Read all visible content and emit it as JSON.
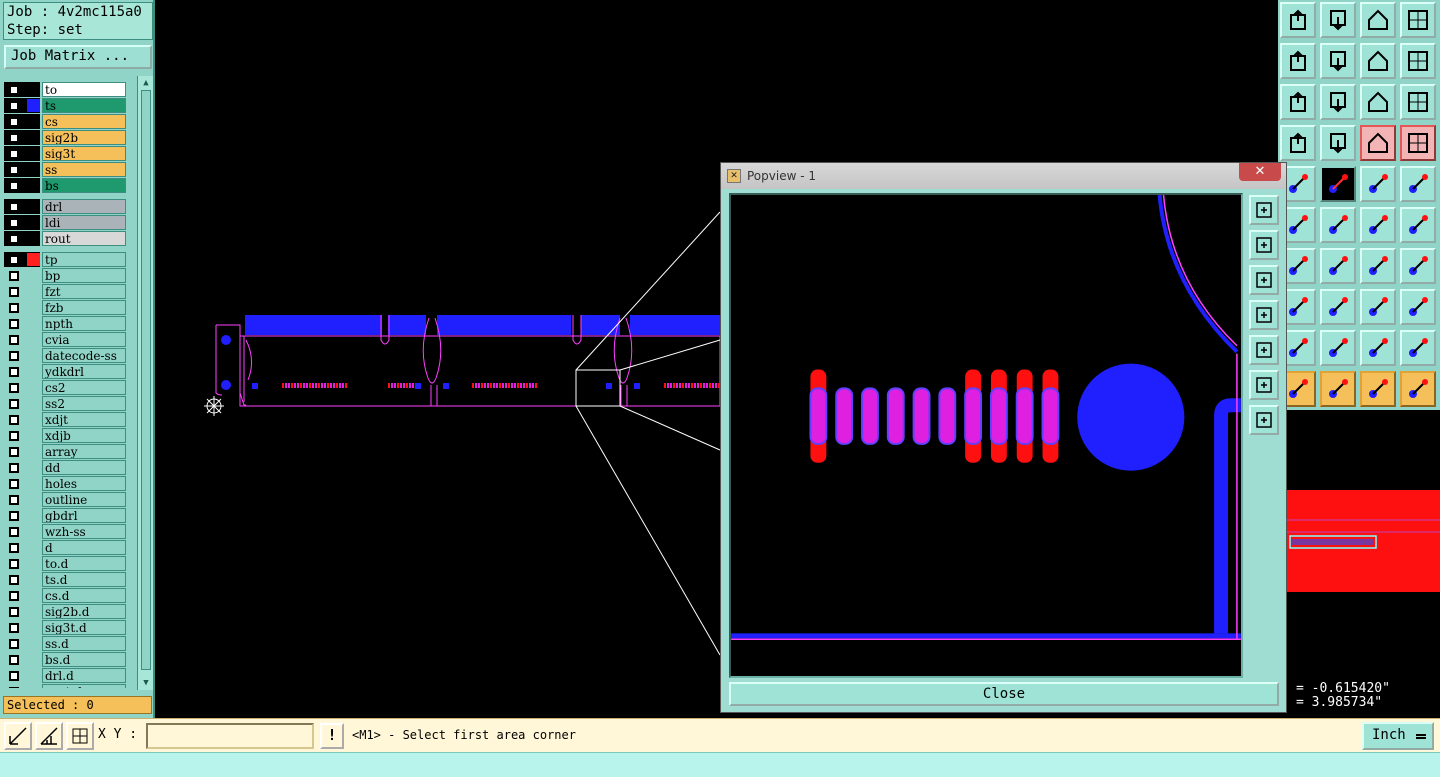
{
  "job": {
    "job_line": "Job : 4v2mc115a0",
    "step_line": "Step: set"
  },
  "job_matrix_label": "Job Matrix ...",
  "layers": [
    {
      "name": "to",
      "color": "#ffffff",
      "swatch": "#000000"
    },
    {
      "name": "ts",
      "color": "#1e9a6e",
      "swatch": "#2020ff"
    },
    {
      "name": "cs",
      "color": "#f5c05a",
      "swatch": "#000000"
    },
    {
      "name": "sig2b",
      "color": "#f5c05a",
      "swatch": "#000000"
    },
    {
      "name": "sig3t",
      "color": "#f5c05a",
      "swatch": "#000000"
    },
    {
      "name": "ss",
      "color": "#f5c05a",
      "swatch": "#000000"
    },
    {
      "name": "bs",
      "color": "#1e9a6e",
      "swatch": "#000000"
    },
    {
      "name": "drl",
      "color": "#aab4b8",
      "swatch": "#000000"
    },
    {
      "name": "ldi",
      "color": "#aab4b8",
      "swatch": "#000000"
    },
    {
      "name": "rout",
      "color": "#d8d8d8",
      "swatch": "#000000"
    },
    {
      "name": "tp",
      "color": "#8fd4c6",
      "swatch": "#ff2020"
    },
    {
      "name": "bp",
      "color": "#8fd4c6",
      "swatch": ""
    },
    {
      "name": "fzt",
      "color": "#8fd4c6",
      "swatch": ""
    },
    {
      "name": "fzb",
      "color": "#8fd4c6",
      "swatch": ""
    },
    {
      "name": "npth",
      "color": "#8fd4c6",
      "swatch": ""
    },
    {
      "name": "cvia",
      "color": "#8fd4c6",
      "swatch": ""
    },
    {
      "name": "datecode-ss",
      "color": "#8fd4c6",
      "swatch": ""
    },
    {
      "name": "ydkdrl",
      "color": "#8fd4c6",
      "swatch": ""
    },
    {
      "name": "cs2",
      "color": "#8fd4c6",
      "swatch": ""
    },
    {
      "name": "ss2",
      "color": "#8fd4c6",
      "swatch": ""
    },
    {
      "name": "xdjt",
      "color": "#8fd4c6",
      "swatch": ""
    },
    {
      "name": "xdjb",
      "color": "#8fd4c6",
      "swatch": ""
    },
    {
      "name": "array",
      "color": "#8fd4c6",
      "swatch": ""
    },
    {
      "name": "dd",
      "color": "#8fd4c6",
      "swatch": ""
    },
    {
      "name": "holes",
      "color": "#8fd4c6",
      "swatch": ""
    },
    {
      "name": "outline",
      "color": "#8fd4c6",
      "swatch": ""
    },
    {
      "name": "gbdrl",
      "color": "#8fd4c6",
      "swatch": ""
    },
    {
      "name": "wzh-ss",
      "color": "#8fd4c6",
      "swatch": ""
    },
    {
      "name": "d",
      "color": "#8fd4c6",
      "swatch": ""
    },
    {
      "name": "to.d",
      "color": "#8fd4c6",
      "swatch": ""
    },
    {
      "name": "ts.d",
      "color": "#8fd4c6",
      "swatch": ""
    },
    {
      "name": "cs.d",
      "color": "#8fd4c6",
      "swatch": ""
    },
    {
      "name": "sig2b.d",
      "color": "#8fd4c6",
      "swatch": ""
    },
    {
      "name": "sig3t.d",
      "color": "#8fd4c6",
      "swatch": ""
    },
    {
      "name": "ss.d",
      "color": "#8fd4c6",
      "swatch": ""
    },
    {
      "name": "bs.d",
      "color": "#8fd4c6",
      "swatch": ""
    },
    {
      "name": "drl.d",
      "color": "#8fd4c6",
      "swatch": ""
    },
    {
      "name": "rout.d",
      "color": "#8fd4c6",
      "swatch": ""
    }
  ],
  "selected_label": "Selected : 0",
  "popview": {
    "title": "Popview - 1",
    "close_x": "✕",
    "close_button": "Close"
  },
  "coords": {
    "x_line": "= -0.615420\"",
    "y_line": "= 3.985734\""
  },
  "bottom": {
    "xy_label": "X Y :",
    "xy_value": "",
    "warn": "!",
    "message": "<M1> - Select first area corner",
    "unit": "Inch"
  },
  "toolbox_icons": [
    "open-step-icon",
    "save-step-icon",
    "home-icon",
    "grid-window-icon",
    "move-left-icon",
    "move-right-icon",
    "rotate-icon",
    "snake-icon",
    "zoom-fit-icon",
    "zoom-center-icon",
    "ratio-icon",
    "help-icon",
    "tools-icon",
    "grid-icon",
    "layers-a-icon",
    "layers-b-icon",
    "feature-icon",
    "line-tool-icon",
    "ruler-icon",
    "pad-icon",
    "connect-icon",
    "cross-icon",
    "snap-icon",
    "arrow-point-icon",
    "line-angle-icon",
    "line-draw-icon",
    "undo-arc-icon",
    "flip-icon",
    "pad-pick-icon",
    "dash-icon",
    "dimension-icon",
    "shape-icon",
    "tri-a-icon",
    "tri-b-icon",
    "tri-c-icon",
    "tri-d-icon",
    "select-arrow-icon",
    "select-box-icon",
    "select-outline-icon",
    "net-select-icon"
  ],
  "colors": {
    "panel": "#8fd4c6",
    "copper": "#2020ff",
    "mask": "#ff1010",
    "outline": "#ff40ff",
    "paste": "#e020e0"
  }
}
